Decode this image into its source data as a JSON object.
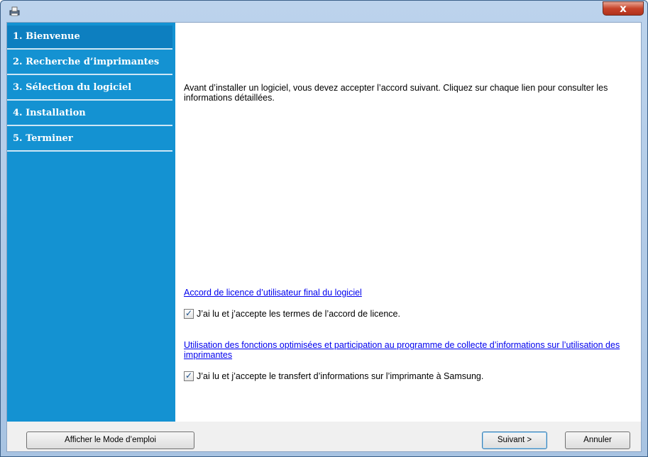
{
  "window": {
    "app_icon": "installer-icon",
    "close_label": "x"
  },
  "sidebar": {
    "steps": [
      {
        "label": "1. Bienvenue"
      },
      {
        "label": "2. Recherche d’imprimantes"
      },
      {
        "label": "3. Sélection du logiciel"
      },
      {
        "label": "4. Installation"
      },
      {
        "label": "5. Terminer"
      }
    ],
    "active_step": 0
  },
  "content": {
    "intro": "Avant d’installer un logiciel, vous devez accepter l’accord suivant. Cliquez sur chaque lien pour consulter les informations détaillées.",
    "license_link": "Accord de licence d’utilisateur final du logiciel",
    "license_checkbox": {
      "label": "J’ai lu et j’accepte les termes de l’accord de licence.",
      "checked": true
    },
    "data_link": "Utilisation des fonctions optimisées et participation au programme de collecte d’informations sur l’utilisation des imprimantes",
    "data_checkbox": {
      "label": "J’ai lu et j’accepte le transfert d’informations sur l’imprimante à Samsung.",
      "checked": true
    }
  },
  "footer": {
    "manual_button": "Afficher le Mode d’emploi",
    "next_button": "Suivant >",
    "cancel_button": "Annuler"
  },
  "colors": {
    "sidebar": "#1492d2",
    "link": "#0000ee",
    "close": "#c7432a"
  }
}
